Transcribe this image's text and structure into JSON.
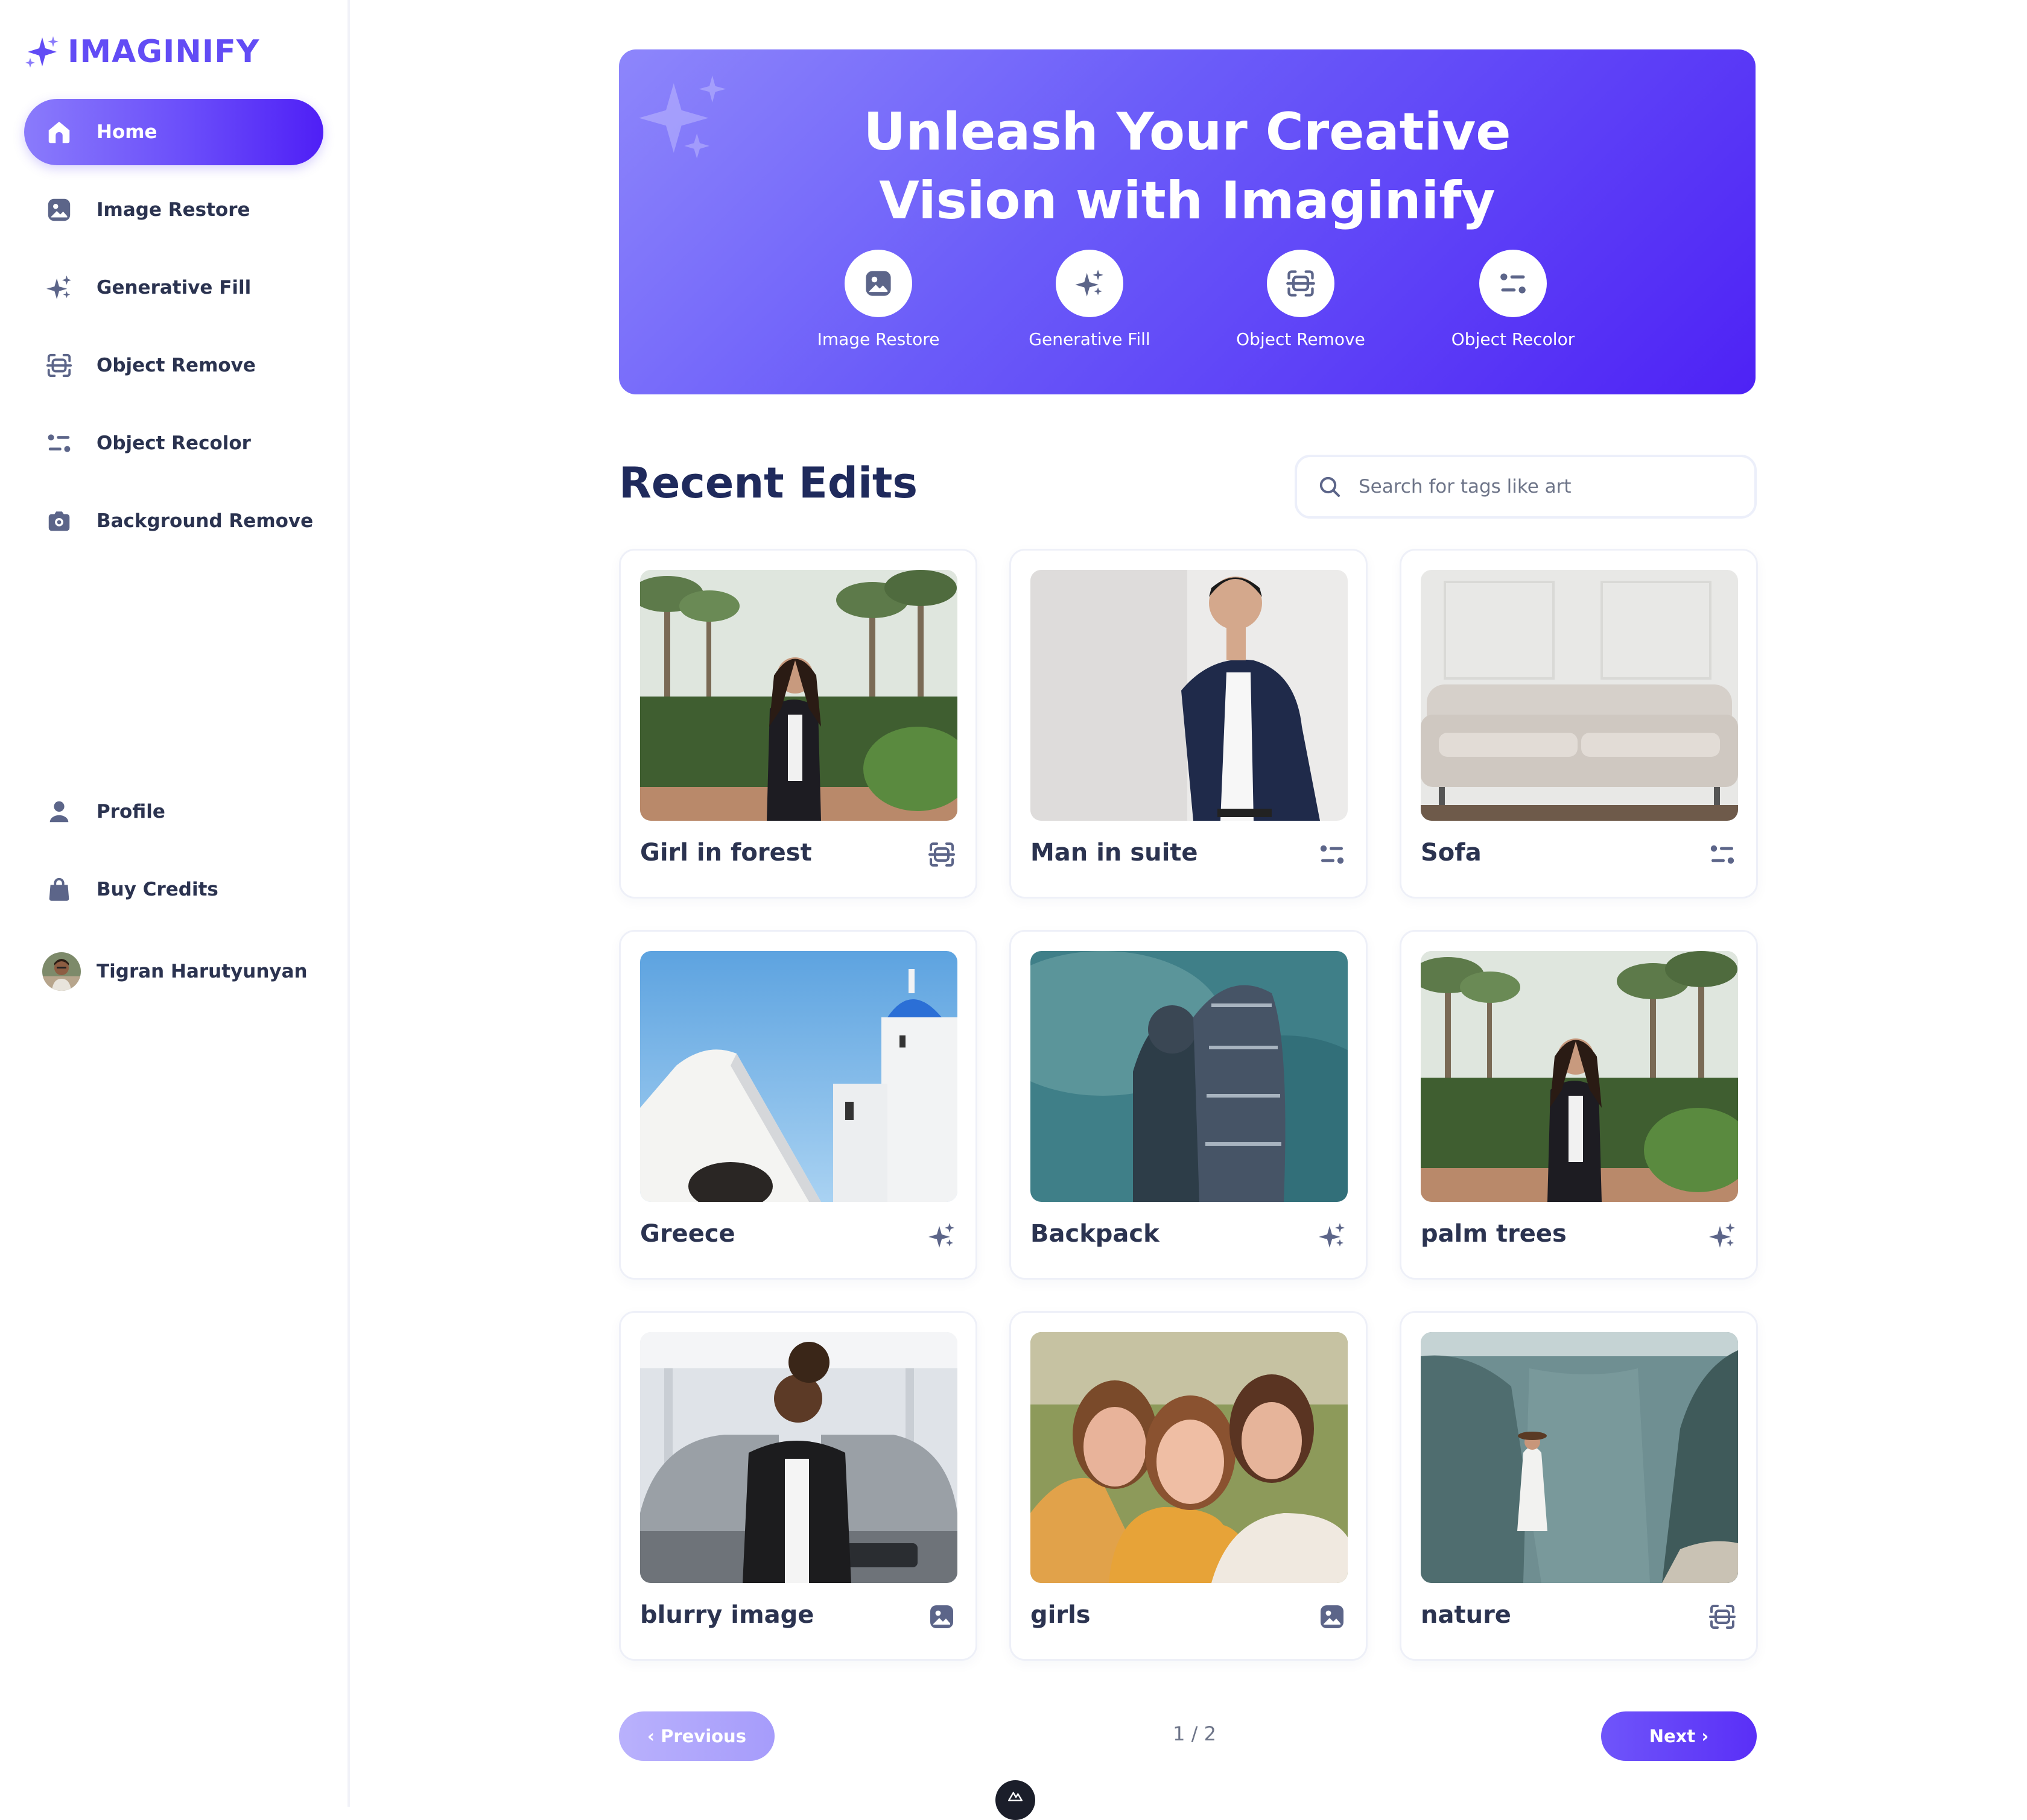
{
  "app": {
    "name": "IMAGINIFY"
  },
  "sidebar": {
    "nav": [
      {
        "label": "Home",
        "icon": "home-icon",
        "active": true
      },
      {
        "label": "Image Restore",
        "icon": "image-icon"
      },
      {
        "label": "Generative Fill",
        "icon": "sparkles-icon"
      },
      {
        "label": "Object Remove",
        "icon": "scan-icon"
      },
      {
        "label": "Object Recolor",
        "icon": "filter-icon"
      },
      {
        "label": "Background Remove",
        "icon": "camera-icon"
      }
    ],
    "bottom": [
      {
        "label": "Profile",
        "icon": "user-icon"
      },
      {
        "label": "Buy Credits",
        "icon": "bag-icon"
      }
    ],
    "user": {
      "name": "Tigran Harutyunyan"
    }
  },
  "hero": {
    "title": "Unleash Your Creative\nVision with Imaginify",
    "actions": [
      {
        "label": "Image Restore",
        "icon": "image-icon"
      },
      {
        "label": "Generative Fill",
        "icon": "sparkles-icon"
      },
      {
        "label": "Object Remove",
        "icon": "scan-icon"
      },
      {
        "label": "Object Recolor",
        "icon": "filter-icon"
      }
    ]
  },
  "recent": {
    "title": "Recent Edits",
    "search_placeholder": "Search for tags like art",
    "items": [
      {
        "title": "Girl in forest",
        "tool_icon": "scan-icon"
      },
      {
        "title": "Man in suite",
        "tool_icon": "filter-icon"
      },
      {
        "title": "Sofa",
        "tool_icon": "filter-icon"
      },
      {
        "title": "Greece",
        "tool_icon": "sparkles-icon"
      },
      {
        "title": "Backpack",
        "tool_icon": "sparkles-icon"
      },
      {
        "title": "palm trees",
        "tool_icon": "sparkles-icon"
      },
      {
        "title": "blurry image",
        "tool_icon": "image-icon"
      },
      {
        "title": "girls",
        "tool_icon": "image-icon"
      },
      {
        "title": "nature",
        "tool_icon": "scan-icon"
      }
    ]
  },
  "pagination": {
    "prev": "‹ Previous",
    "next": "Next ›",
    "current": "1 / 2"
  },
  "colors": {
    "brand": "#624cf5",
    "heading": "#1f2a5c",
    "text": "#2b3350",
    "icon": "#5c6589"
  }
}
